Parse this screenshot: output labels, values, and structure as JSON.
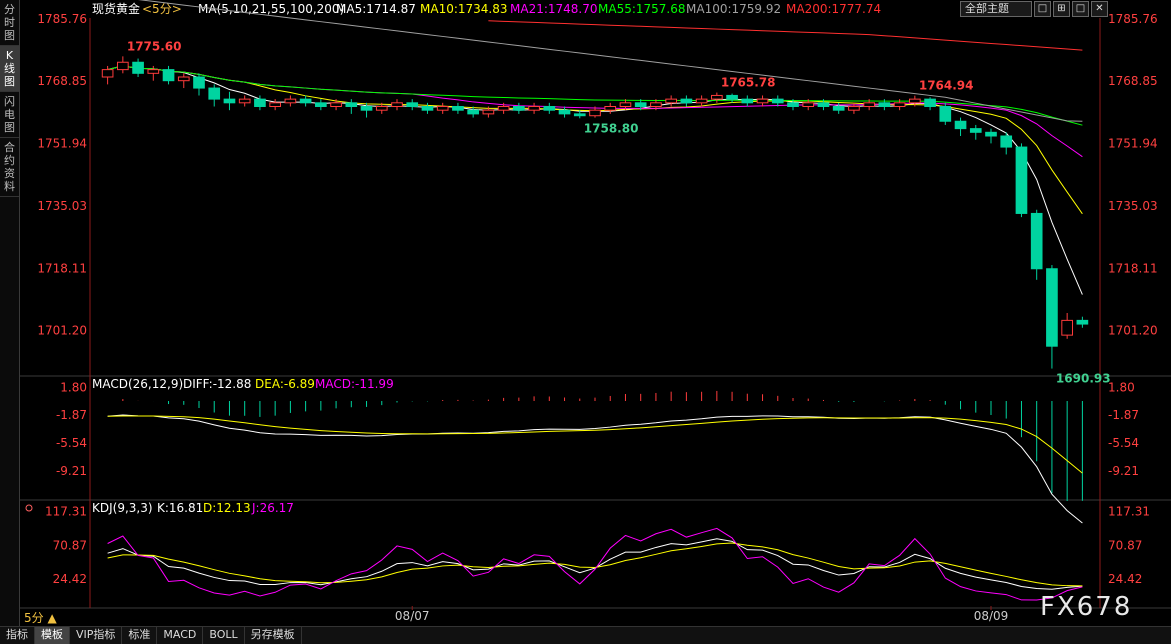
{
  "sidebar": {
    "tabs": [
      {
        "label": "分时图"
      },
      {
        "label": "K线图",
        "active": true
      },
      {
        "label": "闪电图"
      },
      {
        "label": "合约资料"
      }
    ]
  },
  "toolbar": {
    "theme_label": "全部主题",
    "win_buttons": [
      "□",
      "⊞",
      "□",
      "✕"
    ]
  },
  "header": {
    "symbol": "现货黄金",
    "period": "<5分>",
    "ma_label": "MA(5,10,21,55,100,200)",
    "mas": [
      {
        "label": "MA5:1714.87",
        "color": "#ffffff"
      },
      {
        "label": "MA10:1734.83",
        "color": "#ffff00"
      },
      {
        "label": "MA21:1748.70",
        "color": "#ff00ff"
      },
      {
        "label": "MA55:1757.68",
        "color": "#00ff00"
      },
      {
        "label": "MA100:1759.92",
        "color": "#a0a0a0"
      },
      {
        "label": "MA200:1777.74",
        "color": "#ff3030"
      }
    ]
  },
  "macd_header": {
    "label": "MACD(26,12,9)",
    "diff": "DIFF:-12.88",
    "dea": "DEA:-6.89",
    "macd": "MACD:-11.99"
  },
  "kdj_header": {
    "label": "KDJ(9,3,3)",
    "k": "K:16.81",
    "d": "D:12.13",
    "j": "J:26.17"
  },
  "period_selector": "5分 ▲",
  "bottom_tabs": [
    {
      "label": "指标"
    },
    {
      "label": "模板",
      "active": true
    },
    {
      "label": "VIP指标"
    },
    {
      "label": "标准"
    },
    {
      "label": "MACD"
    },
    {
      "label": "BOLL"
    },
    {
      "label": "另存模板"
    }
  ],
  "watermark": "FX678",
  "colors": {
    "up": "#ff3c3c",
    "down": "#00d4a0",
    "ma5": "#ffffff",
    "ma10": "#ffff00",
    "ma21": "#ff00ff",
    "ma55": "#00ff00",
    "ma100": "#a0a0a0",
    "ma200": "#ff3030"
  },
  "chart_data": [
    {
      "type": "candlestick",
      "name": "price",
      "yticks": [
        "1785.76",
        "1768.85",
        "1751.94",
        "1735.03",
        "1718.11",
        "1701.20"
      ],
      "ylim": [
        1690,
        1786
      ],
      "xticks": [
        "08/07",
        "08/09"
      ],
      "annotations": [
        {
          "text": "1775.60",
          "kind": "high"
        },
        {
          "text": "1765.78",
          "kind": "high"
        },
        {
          "text": "1764.94",
          "kind": "high"
        },
        {
          "text": "1758.80",
          "kind": "low"
        },
        {
          "text": "1690.93",
          "kind": "low"
        }
      ],
      "candles": [
        [
          1770,
          1772,
          1768,
          1773
        ],
        [
          1772,
          1774,
          1771,
          1775.6
        ],
        [
          1774,
          1771,
          1770,
          1775
        ],
        [
          1771,
          1772,
          1769,
          1773
        ],
        [
          1772,
          1769,
          1768,
          1773
        ],
        [
          1769,
          1770,
          1767,
          1771
        ],
        [
          1770,
          1767,
          1765,
          1771
        ],
        [
          1767,
          1764,
          1762,
          1768
        ],
        [
          1764,
          1763,
          1761,
          1766
        ],
        [
          1763,
          1764,
          1762,
          1765
        ],
        [
          1764,
          1762,
          1761,
          1765
        ],
        [
          1762,
          1763,
          1761,
          1764
        ],
        [
          1763,
          1764,
          1762,
          1765
        ],
        [
          1764,
          1763,
          1762,
          1765
        ],
        [
          1763,
          1762,
          1761,
          1764
        ],
        [
          1762,
          1763,
          1761,
          1764
        ],
        [
          1763,
          1762,
          1760,
          1764
        ],
        [
          1762,
          1761,
          1759,
          1763
        ],
        [
          1761,
          1762,
          1760,
          1763
        ],
        [
          1762,
          1763,
          1761,
          1764
        ],
        [
          1763,
          1762,
          1761,
          1764
        ],
        [
          1762,
          1761,
          1760,
          1763
        ],
        [
          1761,
          1762,
          1760,
          1763
        ],
        [
          1762,
          1761,
          1760,
          1763
        ],
        [
          1761,
          1760,
          1759,
          1762
        ],
        [
          1760,
          1761,
          1759,
          1762
        ],
        [
          1761,
          1762,
          1760,
          1763
        ],
        [
          1762,
          1761,
          1760,
          1763
        ],
        [
          1761,
          1762,
          1760,
          1763
        ],
        [
          1762,
          1761,
          1760,
          1763
        ],
        [
          1761,
          1760,
          1759,
          1762
        ],
        [
          1760,
          1759.5,
          1758.8,
          1761
        ],
        [
          1759.5,
          1761,
          1759,
          1762
        ],
        [
          1761,
          1762,
          1760,
          1763
        ],
        [
          1762,
          1763,
          1761,
          1764
        ],
        [
          1763,
          1762,
          1761,
          1764
        ],
        [
          1762,
          1763,
          1761,
          1764
        ],
        [
          1763,
          1764,
          1762,
          1765
        ],
        [
          1764,
          1763,
          1762,
          1765
        ],
        [
          1763,
          1764,
          1762,
          1765
        ],
        [
          1764,
          1765,
          1763,
          1765.78
        ],
        [
          1765,
          1764,
          1763,
          1765.5
        ],
        [
          1764,
          1763,
          1762,
          1765
        ],
        [
          1763,
          1764,
          1762,
          1765
        ],
        [
          1764,
          1763,
          1762,
          1765
        ],
        [
          1763,
          1762,
          1761,
          1764
        ],
        [
          1762,
          1763,
          1761,
          1764
        ],
        [
          1763,
          1762,
          1761,
          1764
        ],
        [
          1762,
          1761,
          1760,
          1763
        ],
        [
          1761,
          1762,
          1760,
          1763
        ],
        [
          1762,
          1763,
          1761,
          1764
        ],
        [
          1763,
          1762,
          1761,
          1764
        ],
        [
          1762,
          1763,
          1761,
          1764
        ],
        [
          1763,
          1764,
          1762,
          1764.94
        ],
        [
          1764,
          1762,
          1761,
          1764.5
        ],
        [
          1762,
          1758,
          1757,
          1763
        ],
        [
          1758,
          1756,
          1754,
          1759
        ],
        [
          1756,
          1755,
          1753,
          1757
        ],
        [
          1755,
          1754,
          1752,
          1756
        ],
        [
          1754,
          1751,
          1749,
          1755
        ],
        [
          1751,
          1733,
          1732,
          1752
        ],
        [
          1733,
          1718,
          1715,
          1734
        ],
        [
          1718,
          1697,
          1690.93,
          1719
        ],
        [
          1700,
          1704,
          1699,
          1706
        ],
        [
          1704,
          1703,
          1702,
          1705
        ]
      ]
    },
    {
      "type": "bar+line",
      "name": "MACD",
      "yticks": [
        "1.80",
        "-1.87",
        "-5.54",
        "-9.21"
      ],
      "ylim": [
        -12.5,
        2.5
      ]
    },
    {
      "type": "line",
      "name": "KDJ",
      "yticks": [
        "117.31",
        "70.87",
        "24.42"
      ],
      "ylim": [
        -10,
        125
      ]
    }
  ]
}
